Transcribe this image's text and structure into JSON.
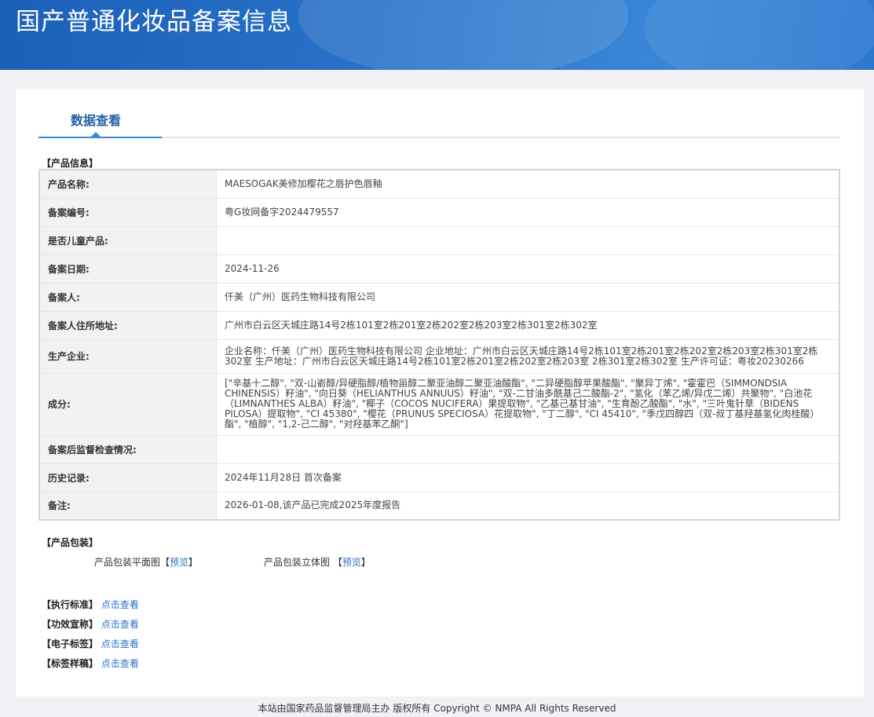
{
  "header": {
    "title": "国产普通化妆品备案信息"
  },
  "tab": {
    "label": "数据查看"
  },
  "product_info": {
    "section_title": "【产品信息】",
    "rows": [
      {
        "label": "产品名称:",
        "value": "MAESOGAK美修加樱花之唇护色唇釉"
      },
      {
        "label": "备案编号:",
        "value": "粤G妆网备字2024479557"
      },
      {
        "label": "是否儿童产品:",
        "value": ""
      },
      {
        "label": "备案日期:",
        "value": "2024-11-26"
      },
      {
        "label": "备案人:",
        "value": "仟美（广州）医药生物科技有限公司"
      },
      {
        "label": "备案人住所地址:",
        "value": "广州市白云区天城庄路14号2栋101室2栋201室2栋202室2栋203室2栋301室2栋302室"
      },
      {
        "label": "生产企业:",
        "value": "企业名称：仟美（广州）医药生物科技有限公司 企业地址：广州市白云区天城庄路14号2栋101室2栋201室2栋202室2栋203室2栋301室2栋302室 生产地址：广州市白云区天城庄路14号2栋101室2栋201室2栋202室2栋203室 2栋301室2栋302室 生产许可证：粤妆20230266"
      },
      {
        "label": "成分:",
        "value": "[\"辛基十二醇\", \"双-山嵛醇/异硬脂醇/植物甾醇二聚亚油醇二聚亚油酸酯\", \"二异硬脂醇苹果酸酯\", \"聚异丁烯\", \"霍霍巴（SIMMONDSIA CHINENSIS）籽油\", \"向日葵（HELIANTHUS ANNUUS）籽油\", \"双-二甘油多酰基己二酸酯-2\", \"氢化（苯乙烯/异戊二烯）共聚物\", \"白池花（LIMNANTHES ALBA）籽油\", \"椰子（COCOS NUCIFERA）果提取物\", \"乙基己基甘油\", \"生育酚乙酸酯\", \"水\", \"三叶鬼针草（BIDENS PILOSA）提取物\", \"CI 45380\", \"樱花（PRUNUS SPECIOSA）花提取物\", \"丁二醇\", \"CI 45410\", \"季戊四醇四（双-叔丁基羟基氢化肉桂酸）酯\", \"植醇\", \"1,2-己二醇\", \"对羟基苯乙酮\"]"
      },
      {
        "label": "备案后监督检查情况:",
        "value": ""
      },
      {
        "label": "历史记录:",
        "value": "2024年11月28日 首次备案"
      },
      {
        "label": "备注:",
        "value": "2026-01-08,该产品已完成2025年度报告"
      }
    ]
  },
  "packaging": {
    "section_title": "【产品包装】",
    "flat_label": "产品包装平面图",
    "flat_link": "预览",
    "solid_label": "产品包装立体图",
    "solid_link": "预览"
  },
  "standards": [
    {
      "label": "【执行标准】",
      "link": "点击查看"
    },
    {
      "label": "【功效宣称】",
      "link": "点击查看"
    },
    {
      "label": "【电子标签】",
      "link": "点击查看"
    },
    {
      "label": "【标签样稿】",
      "link": "点击查看"
    }
  ],
  "footer": {
    "text": "本站由国家药品监督管理局主办 版权所有 Copyright © NMPA All Rights Reserved"
  },
  "colors": {
    "banner": "#2a73c9",
    "link": "#2a73c9",
    "tab_active": "#3a86d6"
  }
}
